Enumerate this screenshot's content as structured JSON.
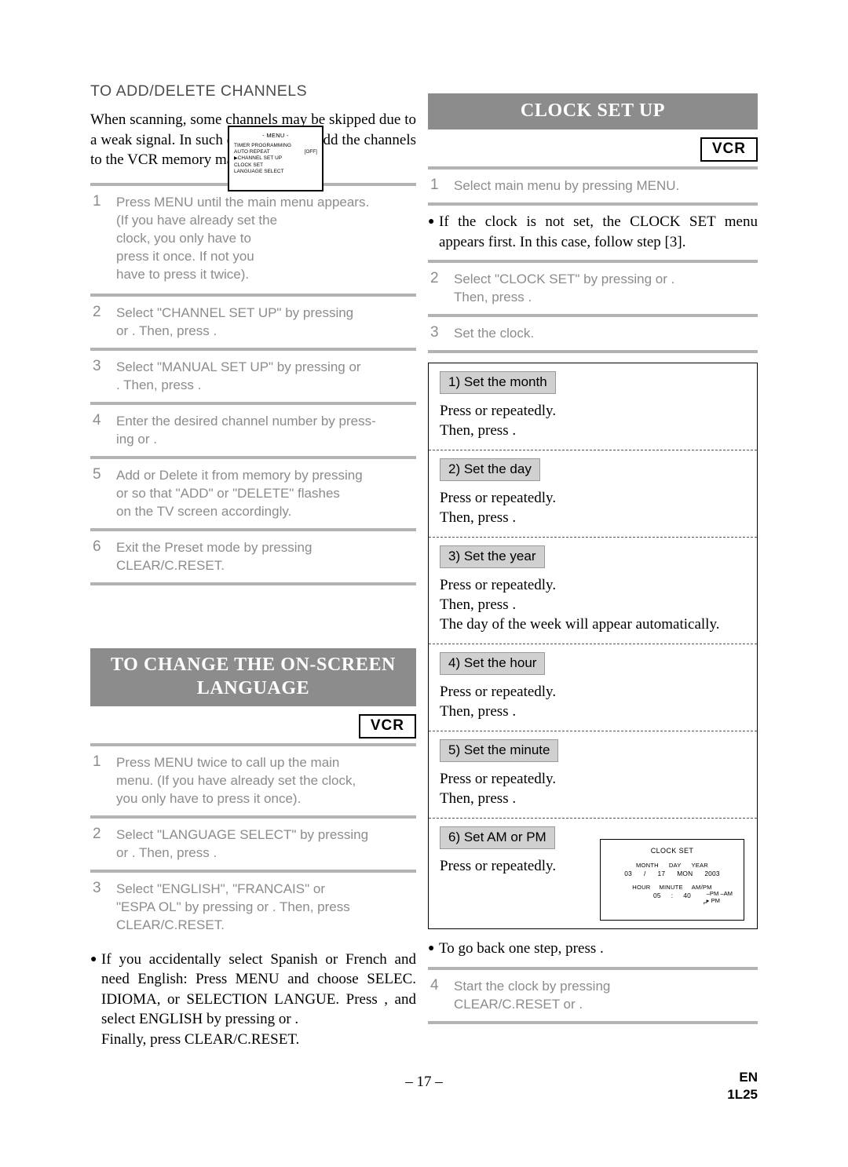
{
  "left": {
    "section1_title": "TO ADD/DELETE CHANNELS",
    "intro": "When scanning, some channels may be skipped due to a weak signal. In such cases, you can add  the channels to the VCR memory manually.",
    "steps": [
      {
        "num": "1",
        "lines": [
          "Press MENU until the main menu appears.",
          "(If you have already set the",
          "clock, you only have to",
          "press it once.  If not you",
          "have to press it twice)."
        ]
      },
      {
        "num": "2",
        "lines": [
          "Select \"CHANNEL SET UP\" by pressing",
          "or    . Then, press       ."
        ]
      },
      {
        "num": "3",
        "lines": [
          "Select \"MANUAL SET UP\" by pressing        or",
          "  . Then, press      ."
        ]
      },
      {
        "num": "4",
        "lines": [
          "Enter the desired channel number by press-",
          "ing        or    ."
        ]
      },
      {
        "num": "5",
        "lines": [
          "Add or Delete it from memory by pressing",
          "        or        so that \"ADD\" or \"DELETE\" flashes",
          "on the TV screen accordingly."
        ]
      },
      {
        "num": "6",
        "lines": [
          "Exit the Preset mode by pressing",
          "CLEAR/C.RESET."
        ]
      }
    ],
    "menu_graphic": {
      "title": "- MENU -",
      "items": [
        "TIMER PROGRAMMING",
        "AUTO REPEAT",
        "CHANNEL SET UP",
        "CLOCK SET",
        "LANGUAGE SELECT"
      ],
      "off_label": "[OFF]"
    },
    "section2_title_line1": "TO CHANGE THE ON-SCREEN",
    "section2_title_line2": "LANGUAGE",
    "vcr_badge": "VCR",
    "steps2": [
      {
        "num": "1",
        "lines": [
          "Press MENU twice to call up the main",
          "menu. (If you have already set the clock,",
          "you only have to press it once)."
        ]
      },
      {
        "num": "2",
        "lines": [
          "Select \"LANGUAGE SELECT\" by pressing",
          "or    . Then, press        ."
        ]
      },
      {
        "num": "3",
        "lines": [
          "Select \"ENGLISH\", \"FRANCAIS\" or",
          "\"ESPA     OL\" by pressing        or     . Then, press",
          "CLEAR/C.RESET."
        ]
      }
    ],
    "note_bullet": "If you accidentally select Spanish or French and need English: Press MENU and choose SELEC. IDIOMA, or SELECTION LANGUE. Press       , and select ENGLISH by pressing     or     .",
    "note_final": "Finally, press CLEAR/C.RESET."
  },
  "right": {
    "title": "CLOCK SET UP",
    "vcr_badge": "VCR",
    "step1": {
      "num": "1",
      "text": "Select main menu by pressing MENU."
    },
    "bullet1": "If the clock is not set, the CLOCK SET menu appears first. In this case, follow step [3].",
    "step2": {
      "num": "2",
      "lines": [
        "Select \"CLOCK SET\" by pressing            or    .",
        "Then, press       ."
      ]
    },
    "step3": {
      "num": "3",
      "text": "Set the clock."
    },
    "clock_steps": [
      {
        "label": "1) Set the month",
        "lines": [
          "Press     or     repeatedly.",
          "Then, press      ."
        ]
      },
      {
        "label": "2) Set the day",
        "lines": [
          "Press     or     repeatedly.",
          "Then, press      ."
        ]
      },
      {
        "label": "3) Set the year",
        "lines": [
          "Press     or     repeatedly.",
          "Then, press      .",
          "The day of the week will appear automatically."
        ]
      },
      {
        "label": "4) Set the hour",
        "lines": [
          "Press     or     repeatedly.",
          "Then, press      ."
        ]
      },
      {
        "label": "5) Set the minute",
        "lines": [
          "Press     or     repeatedly.",
          "Then, press      ."
        ]
      },
      {
        "label": "6) Set AM or PM",
        "lines": [
          "Press     or     repeatedly."
        ]
      }
    ],
    "clock_panel": {
      "title": "CLOCK SET",
      "headers_top": [
        "MONTH",
        "DAY",
        "YEAR"
      ],
      "values_top": [
        "03",
        "/",
        "17",
        "MON",
        "2003"
      ],
      "headers_bottom": [
        "HOUR",
        "MINUTE",
        "AM/PM"
      ],
      "values_bottom": [
        "05",
        ":",
        "40"
      ],
      "ampm": [
        "PM",
        "AM",
        "PM"
      ]
    },
    "bullet2": "To go back one step, press      .",
    "step4": {
      "num": "4",
      "lines": [
        "Start the clock by pressing",
        "CLEAR/C.RESET or      ."
      ]
    }
  },
  "footer": {
    "page": "– 17 –",
    "en": "EN",
    "code": "1L25"
  }
}
